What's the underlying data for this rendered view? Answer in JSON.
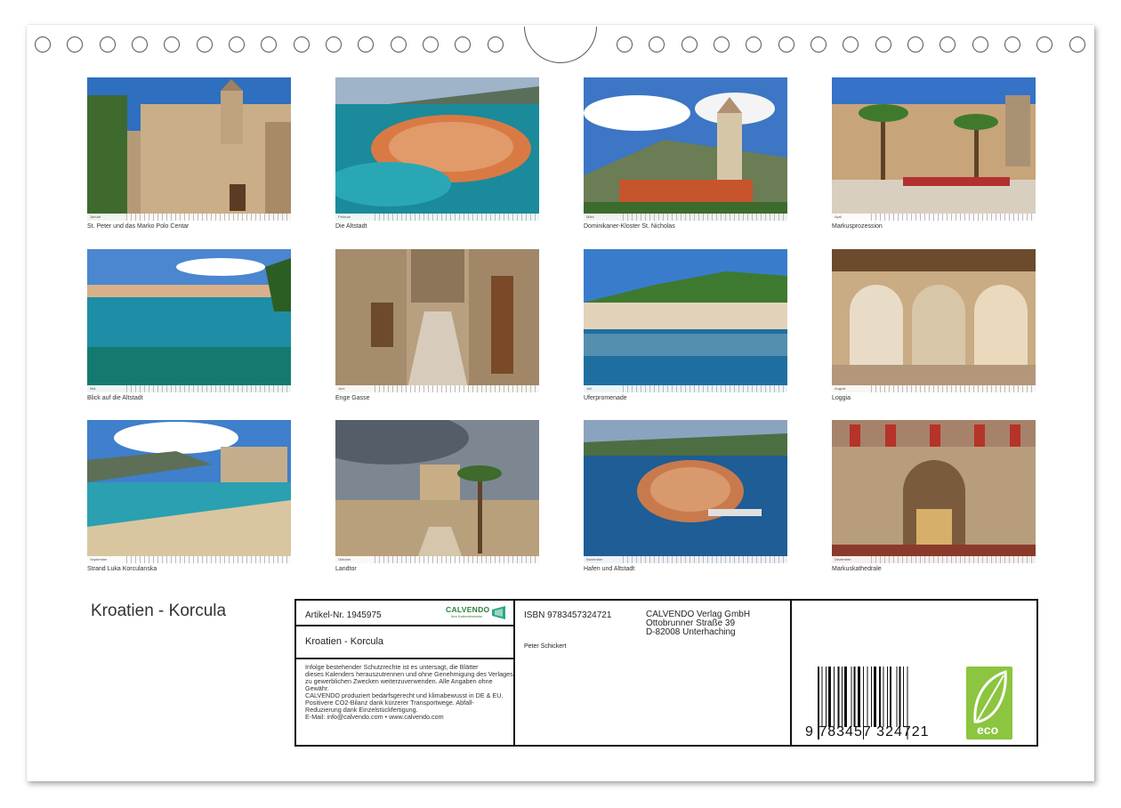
{
  "calendar": {
    "title": "Kroatien - Korcula",
    "months": [
      {
        "month": "Januar",
        "caption": "St. Peter und das Marko Polo Centar"
      },
      {
        "month": "Februar",
        "caption": "Die Altstadt"
      },
      {
        "month": "März",
        "caption": "Dominikaner-Kloster St. Nicholas"
      },
      {
        "month": "April",
        "caption": "Markusprozession"
      },
      {
        "month": "Mai",
        "caption": "Blick auf die Altstadt"
      },
      {
        "month": "Juni",
        "caption": "Enge Gasse"
      },
      {
        "month": "Juli",
        "caption": "Uferpromenade"
      },
      {
        "month": "August",
        "caption": "Loggia"
      },
      {
        "month": "September",
        "caption": "Strand Luka Korculanska"
      },
      {
        "month": "Oktober",
        "caption": "Landtor"
      },
      {
        "month": "November",
        "caption": "Hafen und Altstadt"
      },
      {
        "month": "Dezember",
        "caption": "Markuskathedrale"
      }
    ]
  },
  "info": {
    "article_no": "Artikel-Nr. 1945975",
    "product_title": "Kroatien - Korcula",
    "isbn": "ISBN 9783457324721",
    "author": "Peter Schickert",
    "publisher_lines": [
      "CALVENDO Verlag GmbH",
      "Ottobrunner Straße 39",
      "D-82008 Unterhaching"
    ],
    "legal_lines": [
      "Infolge bestehender Schutzrechte ist es untersagt, die Blätter",
      "dieses Kalenders herauszutrennen und ohne Genehmigung des Verlages",
      "zu gewerblichen Zwecken weiterzuverwenden. Alle Angaben ohne",
      "Gewähr.",
      "CALVENDO produziert bedarfsgerecht und klimabewusst in DE & EU.",
      "Positivere CO2-Bilanz dank kürzerer Transportwege. Abfall-",
      "Reduzierung dank Einzelstückfertigung.",
      "E-Mail: info@calvendo.com • www.calvendo.com"
    ],
    "logo_text": "CALVENDO",
    "logo_sub": "Ihre Kalendermarke",
    "barcode_digits": "9 783457 324721",
    "eco_label": "eco"
  },
  "colors": {
    "frame": "#111111",
    "calvendo_green": "#2d7f3a",
    "eco_green": "#8cc53f"
  }
}
